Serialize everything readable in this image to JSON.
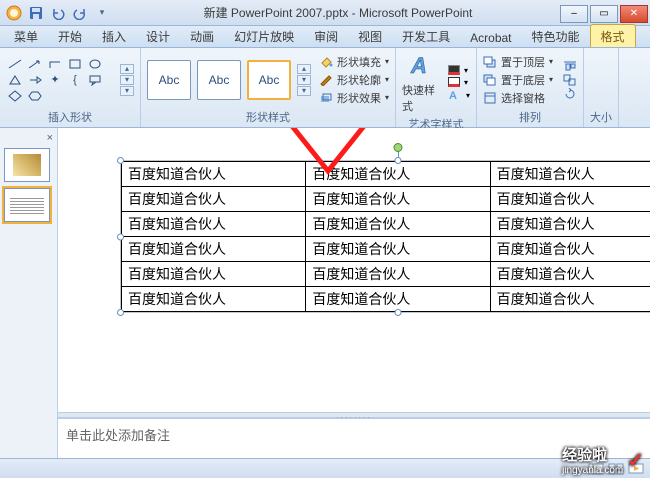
{
  "window": {
    "title": "新建 PowerPoint 2007.pptx - Microsoft PowerPoint"
  },
  "tabs": [
    "菜单",
    "开始",
    "插入",
    "设计",
    "动画",
    "幻灯片放映",
    "审阅",
    "视图",
    "开发工具",
    "Acrobat",
    "特色功能",
    "格式"
  ],
  "active_tab": 11,
  "ribbon": {
    "insert_shapes": "插入形状",
    "shape_styles": "形状样式",
    "wordart_styles": "艺术字样式",
    "arrange": "排列",
    "style_abc": "Abc",
    "shape_fill": "形状填充",
    "shape_outline": "形状轮廓",
    "shape_effects": "形状效果",
    "quick_styles": "快速样式",
    "bring_front": "置于顶层",
    "send_back": "置于底层",
    "selection_pane": "选择窗格",
    "size_label": "大小"
  },
  "thumbnails": {
    "close": "×"
  },
  "table": {
    "cell_text": "百度知道合伙人",
    "rows": 6,
    "cols": 3
  },
  "notes": {
    "placeholder": "单击此处添加备注"
  },
  "watermark": {
    "brand": "经验啦",
    "url": "jingyanla.com"
  },
  "colors": {
    "arrow": "#ff1a1a"
  }
}
